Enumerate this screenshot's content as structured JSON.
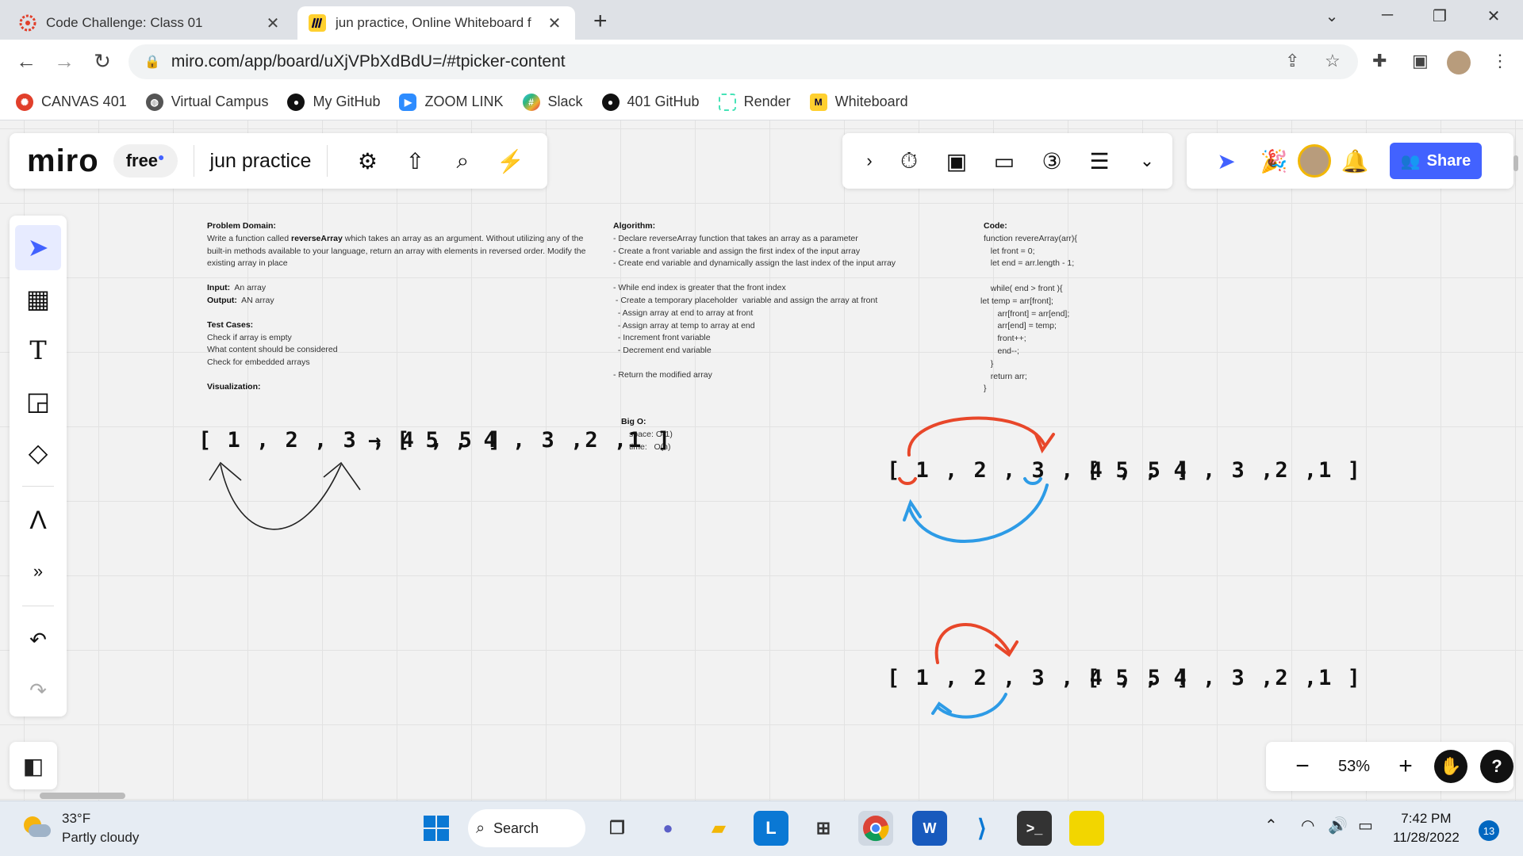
{
  "browser": {
    "tabs": [
      {
        "title": "Code Challenge: Class 01",
        "active": false
      },
      {
        "title": "jun practice, Online Whiteboard f",
        "active": true
      }
    ],
    "url": "miro.com/app/board/uXjVPbXdBdU=/#tpicker-content",
    "bookmarks": [
      "CANVAS 401",
      "Virtual Campus",
      "My GitHub",
      "ZOOM LINK",
      "Slack",
      "401 GitHub",
      "Render",
      "Whiteboard"
    ]
  },
  "miro": {
    "logo": "miro",
    "plan": "free",
    "board_name": "jun practice",
    "share_label": "Share",
    "zoom": "53%",
    "help": "?"
  },
  "board": {
    "problem": {
      "heading": "Problem Domain:",
      "text_pre": "Write a function called ",
      "text_bold": "reverseArray",
      "text_post": " which takes an array as an argument. Without utilizing any of the built-in methods available to your language, return an array with elements in reversed order. Modify the existing array in place",
      "input_label": "Input:",
      "input_value": "An array",
      "output_label": "Output:",
      "output_value": "AN array",
      "tests_heading": "Test Cases:",
      "tests": [
        "Check if array is empty",
        "What content should be considered",
        "Check for embedded arrays"
      ],
      "visualization_label": "Visualization:"
    },
    "algorithm": {
      "heading": "Algorithm:",
      "steps": [
        "- Declare reverseArray function that takes an array as a parameter",
        "- Create a front variable and assign the first index of the input array",
        "- Create end variable and dynamically assign the last index of the input array"
      ],
      "loop_steps": [
        "- While end index is greater that the front index",
        " - Create a temporary placeholder  variable and assign the array at front",
        "  - Assign array at end to array at front",
        "  - Assign array at temp to array at end",
        "  - Increment front variable",
        "  - Decrement end variable"
      ],
      "return_step": "- Return the modified array"
    },
    "bigo": {
      "heading": "Big O:",
      "space": "space: O(1)",
      "time": "time:   O(n)"
    },
    "code": {
      "heading": "Code:",
      "lines": [
        "function revereArray(arr){",
        "   let front = 0;",
        "   let end = arr.length - 1;",
        "",
        "   while( end > front ){",
        "let temp = arr[front];",
        "      arr[front] = arr[end];",
        "      arr[end] = temp;",
        "      front++;",
        "      end--;",
        "   }",
        "   return arr;",
        "}"
      ]
    },
    "visual_left": {
      "input": "[ 1 , 2 , 3 , 4 , 5 ]",
      "arrow": "→",
      "output": "[ 5 , 4 , 3 ,2 ,1 ]"
    },
    "visual_right_1": {
      "input": "[ 1 , 2 , 3 , 4 , 5 ]",
      "output": "[ 5 , 4 , 3 ,2 ,1 ]"
    },
    "visual_right_2": {
      "input": "[ 1 , 2 , 3 , 4 , 5 ]",
      "output": "[ 5 , 4 , 3 ,2 ,1 ]"
    },
    "stroke_colors": {
      "red": "#e8472a",
      "blue": "#2d9be6",
      "black": "#222222"
    }
  },
  "taskbar": {
    "temperature": "33°F",
    "weather": "Partly cloudy",
    "search_label": "Search",
    "time": "7:42 PM",
    "date": "11/28/2022",
    "notifications": "13"
  }
}
